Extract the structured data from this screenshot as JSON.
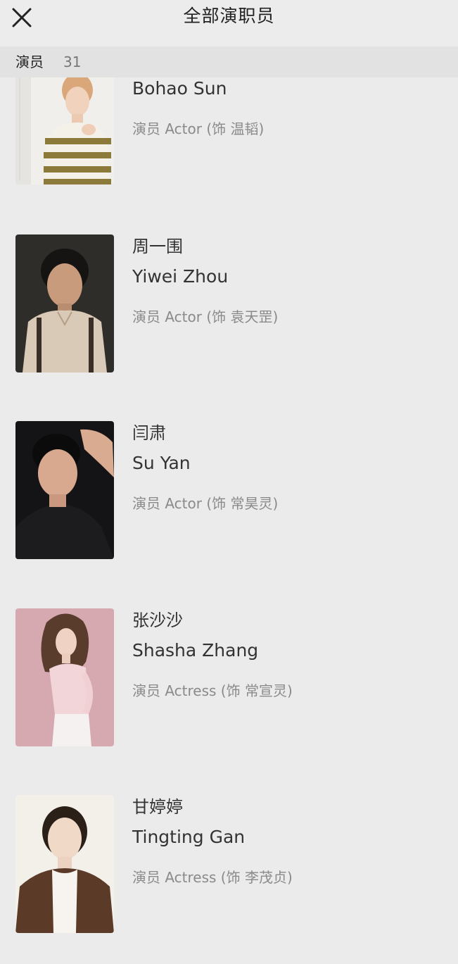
{
  "header": {
    "title": "全部演职员",
    "close_icon": "close-icon"
  },
  "section": {
    "label": "演员",
    "count": "31"
  },
  "cast": [
    {
      "zh_name": "",
      "en_name": "Bohao Sun",
      "role": "演员 Actor (饰 温韬)"
    },
    {
      "zh_name": "周一围",
      "en_name": "Yiwei Zhou",
      "role": "演员 Actor (饰 袁天罡)"
    },
    {
      "zh_name": "闫肃",
      "en_name": "Su Yan",
      "role": "演员 Actor (饰 常昊灵)"
    },
    {
      "zh_name": "张沙沙",
      "en_name": "Shasha Zhang",
      "role": "演员 Actress (饰 常宣灵)"
    },
    {
      "zh_name": "甘婷婷",
      "en_name": "Tingting Gan",
      "role": "演员 Actress (饰 李茂贞)"
    }
  ],
  "colors": {
    "background": "#ebebeb",
    "section_bg": "#e2e2e2",
    "primary_text": "#333333",
    "secondary_text": "#8a8a8a"
  }
}
